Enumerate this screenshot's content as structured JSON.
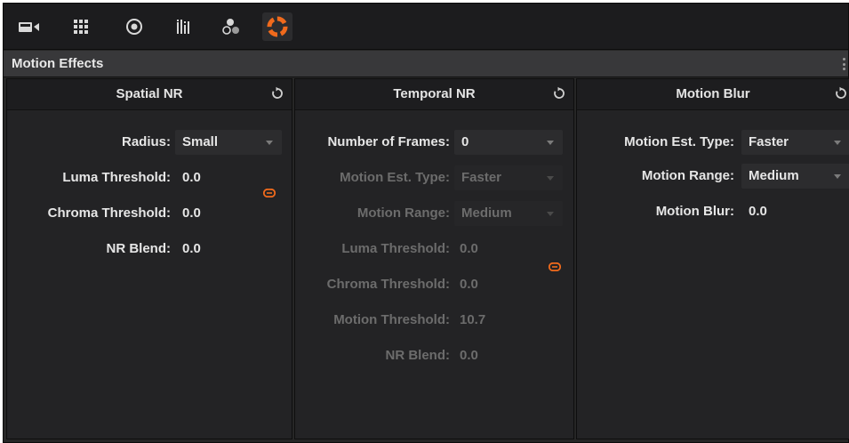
{
  "toolbar": {
    "tools": [
      {
        "icon": "camera-icon"
      },
      {
        "icon": "grid-icon"
      },
      {
        "icon": "circle-target-icon"
      },
      {
        "icon": "bar-meter-icon"
      },
      {
        "icon": "nodes-icon"
      },
      {
        "icon": "motion-effects-icon",
        "active": true
      }
    ]
  },
  "panel_title": "Motion Effects",
  "spatial": {
    "title": "Spatial NR",
    "radius_label": "Radius:",
    "radius_value": "Small",
    "luma_label": "Luma Threshold:",
    "luma_value": "0.0",
    "chroma_label": "Chroma Threshold:",
    "chroma_value": "0.0",
    "blend_label": "NR Blend:",
    "blend_value": "0.0"
  },
  "temporal": {
    "title": "Temporal NR",
    "frames_label": "Number of Frames:",
    "frames_value": "0",
    "est_label": "Motion Est. Type:",
    "est_value": "Faster",
    "range_label": "Motion Range:",
    "range_value": "Medium",
    "luma_label": "Luma Threshold:",
    "luma_value": "0.0",
    "chroma_label": "Chroma Threshold:",
    "chroma_value": "0.0",
    "motion_label": "Motion Threshold:",
    "motion_value": "10.7",
    "blend_label": "NR Blend:",
    "blend_value": "0.0"
  },
  "blur": {
    "title": "Motion Blur",
    "est_label": "Motion Est. Type:",
    "est_value": "Faster",
    "range_label": "Motion Range:",
    "range_value": "Medium",
    "blur_label": "Motion Blur:",
    "blur_value": "0.0"
  },
  "colors": {
    "accent": "#f06a1c",
    "text": "#e6e6e6",
    "disabled": "#6c6c6c",
    "panel_bg": "#232325"
  }
}
